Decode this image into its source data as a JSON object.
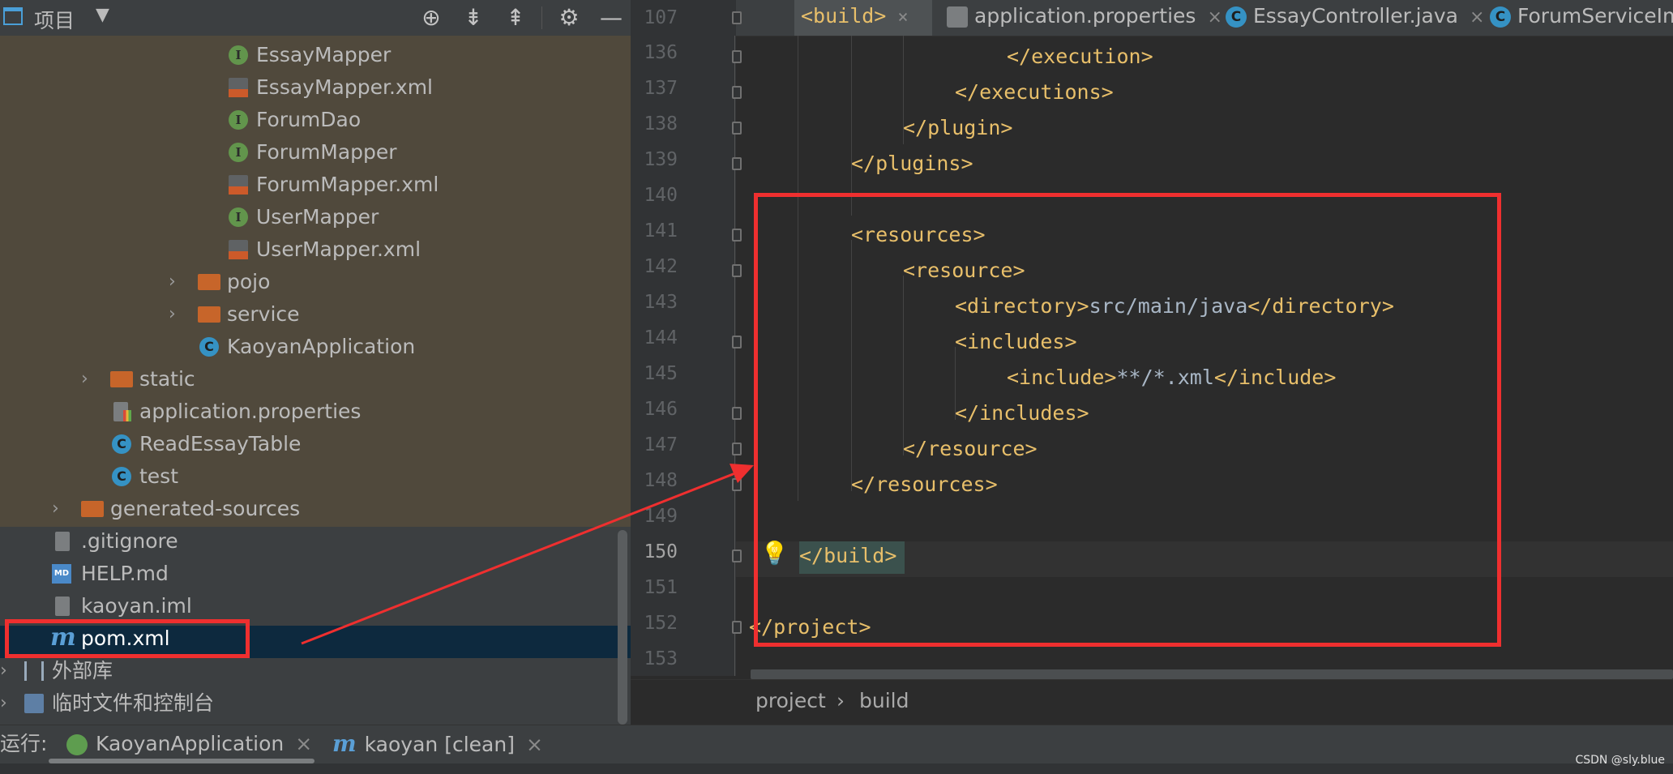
{
  "project_panel": {
    "title": "项目",
    "tree": [
      {
        "label": "EssayMapper",
        "icon": "interface-icon"
      },
      {
        "label": "EssayMapper.xml",
        "icon": "xml-file-icon"
      },
      {
        "label": "ForumDao",
        "icon": "interface-icon"
      },
      {
        "label": "ForumMapper",
        "icon": "interface-icon"
      },
      {
        "label": "ForumMapper.xml",
        "icon": "xml-file-icon"
      },
      {
        "label": "UserMapper",
        "icon": "interface-icon"
      },
      {
        "label": "UserMapper.xml",
        "icon": "xml-file-icon"
      },
      {
        "label": "pojo",
        "icon": "folder-icon"
      },
      {
        "label": "service",
        "icon": "folder-icon"
      },
      {
        "label": "KaoyanApplication",
        "icon": "spring-class-icon"
      },
      {
        "label": "static",
        "icon": "folder-icon"
      },
      {
        "label": "application.properties",
        "icon": "properties-file-icon"
      },
      {
        "label": "ReadEssayTable",
        "icon": "class-icon"
      },
      {
        "label": "test",
        "icon": "class-icon"
      },
      {
        "label": "generated-sources",
        "icon": "folder-icon"
      },
      {
        "label": ".gitignore",
        "icon": "ignore-file-icon"
      },
      {
        "label": "HELP.md",
        "icon": "markdown-file-icon"
      },
      {
        "label": "kaoyan.iml",
        "icon": "iml-file-icon"
      },
      {
        "label": "pom.xml",
        "icon": "maven-icon"
      },
      {
        "label": "外部库",
        "icon": "library-icon"
      },
      {
        "label": "临时文件和控制台",
        "icon": "scratch-icon"
      }
    ]
  },
  "editor": {
    "tabs": [
      {
        "label": "<build>"
      },
      {
        "label": "application.properties"
      },
      {
        "label": "EssayController.java"
      },
      {
        "label": "ForumServiceIm"
      }
    ],
    "tab_close": "×",
    "sticky_line_number": "107",
    "lines": [
      {
        "num": "136",
        "code": "</execution>"
      },
      {
        "num": "137",
        "code": "</executions>"
      },
      {
        "num": "138",
        "code": "</plugin>"
      },
      {
        "num": "139",
        "code": "</plugins>"
      },
      {
        "num": "140",
        "code": ""
      },
      {
        "num": "141",
        "code": "<resources>"
      },
      {
        "num": "142",
        "code": "<resource>"
      },
      {
        "num": "143a",
        "code": "<directory>"
      },
      {
        "num": "143b",
        "code": "src/main/java"
      },
      {
        "num": "143c",
        "code": "</directory>"
      },
      {
        "num": "144",
        "code": "<includes>"
      },
      {
        "num": "145a",
        "code": "<include>"
      },
      {
        "num": "145b",
        "code": "**/*.xml"
      },
      {
        "num": "145c",
        "code": "</include>"
      },
      {
        "num": "146",
        "code": "</includes>"
      },
      {
        "num": "147",
        "code": "</resource>"
      },
      {
        "num": "148",
        "code": "</resources>"
      },
      {
        "num": "150",
        "code": "</build>"
      },
      {
        "num": "152",
        "code": "</project>"
      }
    ],
    "line_numbers": [
      "136",
      "137",
      "138",
      "139",
      "140",
      "141",
      "142",
      "143",
      "144",
      "145",
      "146",
      "147",
      "148",
      "149",
      "150",
      "151",
      "152",
      "153"
    ],
    "breadcrumb": [
      "project",
      "build"
    ],
    "breadcrumb_sep": "›"
  },
  "run_bar": {
    "label": "运行:",
    "items": [
      {
        "label": "KaoyanApplication"
      },
      {
        "label": "kaoyan [clean]"
      }
    ],
    "close": "×"
  },
  "watermark": "CSDN @sly.blue",
  "colors": {
    "annotation_red": "#ef2f2f",
    "xml_tag": "#e8bf6a",
    "text": "#a9b7c6"
  }
}
